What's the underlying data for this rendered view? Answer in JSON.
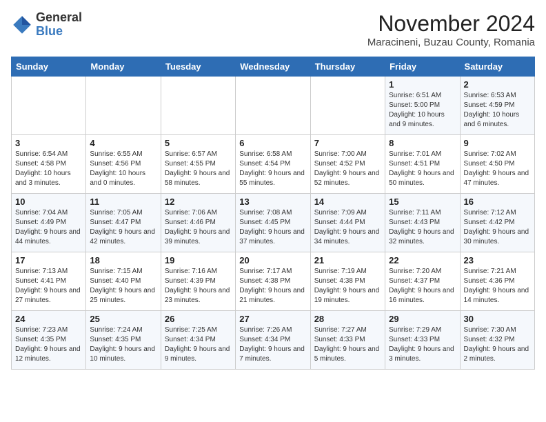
{
  "logo": {
    "line1": "General",
    "line2": "Blue"
  },
  "title": "November 2024",
  "subtitle": "Maracineni, Buzau County, Romania",
  "days_of_week": [
    "Sunday",
    "Monday",
    "Tuesday",
    "Wednesday",
    "Thursday",
    "Friday",
    "Saturday"
  ],
  "weeks": [
    [
      {
        "day": "",
        "info": ""
      },
      {
        "day": "",
        "info": ""
      },
      {
        "day": "",
        "info": ""
      },
      {
        "day": "",
        "info": ""
      },
      {
        "day": "",
        "info": ""
      },
      {
        "day": "1",
        "info": "Sunrise: 6:51 AM\nSunset: 5:00 PM\nDaylight: 10 hours and 9 minutes."
      },
      {
        "day": "2",
        "info": "Sunrise: 6:53 AM\nSunset: 4:59 PM\nDaylight: 10 hours and 6 minutes."
      }
    ],
    [
      {
        "day": "3",
        "info": "Sunrise: 6:54 AM\nSunset: 4:58 PM\nDaylight: 10 hours and 3 minutes."
      },
      {
        "day": "4",
        "info": "Sunrise: 6:55 AM\nSunset: 4:56 PM\nDaylight: 10 hours and 0 minutes."
      },
      {
        "day": "5",
        "info": "Sunrise: 6:57 AM\nSunset: 4:55 PM\nDaylight: 9 hours and 58 minutes."
      },
      {
        "day": "6",
        "info": "Sunrise: 6:58 AM\nSunset: 4:54 PM\nDaylight: 9 hours and 55 minutes."
      },
      {
        "day": "7",
        "info": "Sunrise: 7:00 AM\nSunset: 4:52 PM\nDaylight: 9 hours and 52 minutes."
      },
      {
        "day": "8",
        "info": "Sunrise: 7:01 AM\nSunset: 4:51 PM\nDaylight: 9 hours and 50 minutes."
      },
      {
        "day": "9",
        "info": "Sunrise: 7:02 AM\nSunset: 4:50 PM\nDaylight: 9 hours and 47 minutes."
      }
    ],
    [
      {
        "day": "10",
        "info": "Sunrise: 7:04 AM\nSunset: 4:49 PM\nDaylight: 9 hours and 44 minutes."
      },
      {
        "day": "11",
        "info": "Sunrise: 7:05 AM\nSunset: 4:47 PM\nDaylight: 9 hours and 42 minutes."
      },
      {
        "day": "12",
        "info": "Sunrise: 7:06 AM\nSunset: 4:46 PM\nDaylight: 9 hours and 39 minutes."
      },
      {
        "day": "13",
        "info": "Sunrise: 7:08 AM\nSunset: 4:45 PM\nDaylight: 9 hours and 37 minutes."
      },
      {
        "day": "14",
        "info": "Sunrise: 7:09 AM\nSunset: 4:44 PM\nDaylight: 9 hours and 34 minutes."
      },
      {
        "day": "15",
        "info": "Sunrise: 7:11 AM\nSunset: 4:43 PM\nDaylight: 9 hours and 32 minutes."
      },
      {
        "day": "16",
        "info": "Sunrise: 7:12 AM\nSunset: 4:42 PM\nDaylight: 9 hours and 30 minutes."
      }
    ],
    [
      {
        "day": "17",
        "info": "Sunrise: 7:13 AM\nSunset: 4:41 PM\nDaylight: 9 hours and 27 minutes."
      },
      {
        "day": "18",
        "info": "Sunrise: 7:15 AM\nSunset: 4:40 PM\nDaylight: 9 hours and 25 minutes."
      },
      {
        "day": "19",
        "info": "Sunrise: 7:16 AM\nSunset: 4:39 PM\nDaylight: 9 hours and 23 minutes."
      },
      {
        "day": "20",
        "info": "Sunrise: 7:17 AM\nSunset: 4:38 PM\nDaylight: 9 hours and 21 minutes."
      },
      {
        "day": "21",
        "info": "Sunrise: 7:19 AM\nSunset: 4:38 PM\nDaylight: 9 hours and 19 minutes."
      },
      {
        "day": "22",
        "info": "Sunrise: 7:20 AM\nSunset: 4:37 PM\nDaylight: 9 hours and 16 minutes."
      },
      {
        "day": "23",
        "info": "Sunrise: 7:21 AM\nSunset: 4:36 PM\nDaylight: 9 hours and 14 minutes."
      }
    ],
    [
      {
        "day": "24",
        "info": "Sunrise: 7:23 AM\nSunset: 4:35 PM\nDaylight: 9 hours and 12 minutes."
      },
      {
        "day": "25",
        "info": "Sunrise: 7:24 AM\nSunset: 4:35 PM\nDaylight: 9 hours and 10 minutes."
      },
      {
        "day": "26",
        "info": "Sunrise: 7:25 AM\nSunset: 4:34 PM\nDaylight: 9 hours and 9 minutes."
      },
      {
        "day": "27",
        "info": "Sunrise: 7:26 AM\nSunset: 4:34 PM\nDaylight: 9 hours and 7 minutes."
      },
      {
        "day": "28",
        "info": "Sunrise: 7:27 AM\nSunset: 4:33 PM\nDaylight: 9 hours and 5 minutes."
      },
      {
        "day": "29",
        "info": "Sunrise: 7:29 AM\nSunset: 4:33 PM\nDaylight: 9 hours and 3 minutes."
      },
      {
        "day": "30",
        "info": "Sunrise: 7:30 AM\nSunset: 4:32 PM\nDaylight: 9 hours and 2 minutes."
      }
    ]
  ]
}
